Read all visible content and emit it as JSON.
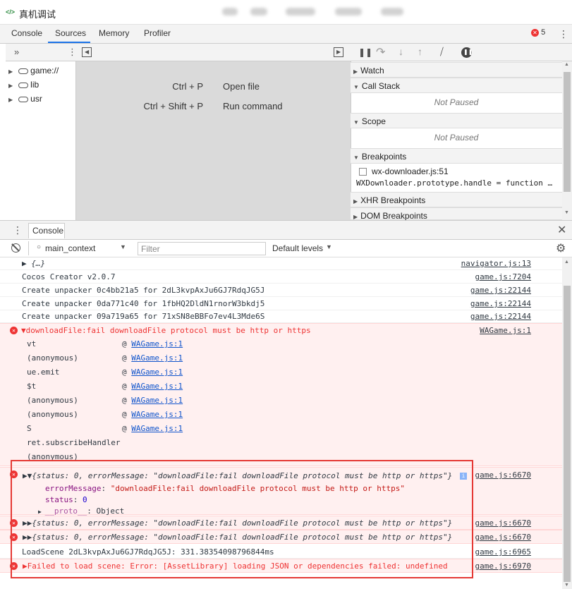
{
  "window": {
    "title": "真机调试"
  },
  "tabs": [
    "Console",
    "Sources",
    "Memory",
    "Profiler"
  ],
  "errors_count": "5",
  "navigator": {
    "items": [
      "game://",
      "lib",
      "usr"
    ]
  },
  "editor": {
    "shortcuts": [
      {
        "keys": "Ctrl + P",
        "label": "Open file"
      },
      {
        "keys": "Ctrl + Shift + P",
        "label": "Run command"
      }
    ]
  },
  "debugger": {
    "watch": "Watch",
    "callstack": "Call Stack",
    "not_paused": "Not Paused",
    "scope": "Scope",
    "breakpoints": "Breakpoints",
    "bp_file": "wx-downloader.js:51",
    "bp_code": "WXDownloader.prototype.handle = function …",
    "xhr": "XHR Breakpoints",
    "dom": "DOM Breakpoints"
  },
  "drawer": {
    "tab": "Console"
  },
  "console_toolbar": {
    "context": "main_context",
    "filter_placeholder": "Filter",
    "levels": "Default levels"
  },
  "console": {
    "lines": [
      {
        "msg": "▶ {…}",
        "src": "navigator.js:13"
      },
      {
        "msg": "Cocos Creator v2.0.7",
        "src": "game.js:7204"
      },
      {
        "msg": "Create unpacker 0c4bb21a5 for 2dL3kvpAxJu6GJ7RdqJG5J",
        "src": "game.js:22144"
      },
      {
        "msg": "Create unpacker 0da771c40 for 1fbHQ2DldN1rnorW3bkdj5",
        "src": "game.js:22144"
      },
      {
        "msg": "Create unpacker 09a719a65 for 71xSN8eBBFo7ev4L3Mde6S",
        "src": "game.js:22144"
      }
    ],
    "error1": {
      "msg": "downloadFile:fail downloadFile protocol must be http or https",
      "src": "WAGame.js:1"
    },
    "stack": [
      {
        "fn": "vt",
        "at": "@",
        "link": "WAGame.js:1"
      },
      {
        "fn": "(anonymous)",
        "at": "@",
        "link": "WAGame.js:1"
      },
      {
        "fn": "ue.emit",
        "at": "@",
        "link": "WAGame.js:1"
      },
      {
        "fn": "$t",
        "at": "@",
        "link": "WAGame.js:1"
      },
      {
        "fn": "(anonymous)",
        "at": "@",
        "link": "WAGame.js:1"
      },
      {
        "fn": "(anonymous)",
        "at": "@",
        "link": "WAGame.js:1"
      },
      {
        "fn": "S",
        "at": "@",
        "link": "WAGame.js:1"
      },
      {
        "fn": "ret.subscribeHandler",
        "at": "",
        "link": ""
      },
      {
        "fn": "(anonymous)",
        "at": "",
        "link": ""
      }
    ],
    "obj1": {
      "summary": "{status: 0, errorMessage: \"downloadFile:fail downloadFile protocol must be http or https\"}",
      "src": "game.js:6670",
      "err_key": "errorMessage",
      "err_val": "\"downloadFile:fail downloadFile protocol must be http or https\"",
      "status_key": "status",
      "status_val": "0",
      "proto_key": "__proto__",
      "proto_val": "Object"
    },
    "obj2": {
      "summary": "{status: 0, errorMessage: \"downloadFile:fail downloadFile protocol must be http or https\"}",
      "src": "game.js:6670"
    },
    "obj3": {
      "summary": "{status: 0, errorMessage: \"downloadFile:fail downloadFile protocol must be http or https\"}",
      "src": "game.js:6670"
    },
    "loadscene": {
      "msg": "LoadScene 2dL3kvpAxJu6GJ7RdqJG5J: 331.38354098796844ms",
      "src": "game.js:6965"
    },
    "error2": {
      "msg": "Failed to load scene: Error: [AssetLibrary] loading JSON or dependencies failed: undefined",
      "src": "game.js:6970"
    }
  }
}
